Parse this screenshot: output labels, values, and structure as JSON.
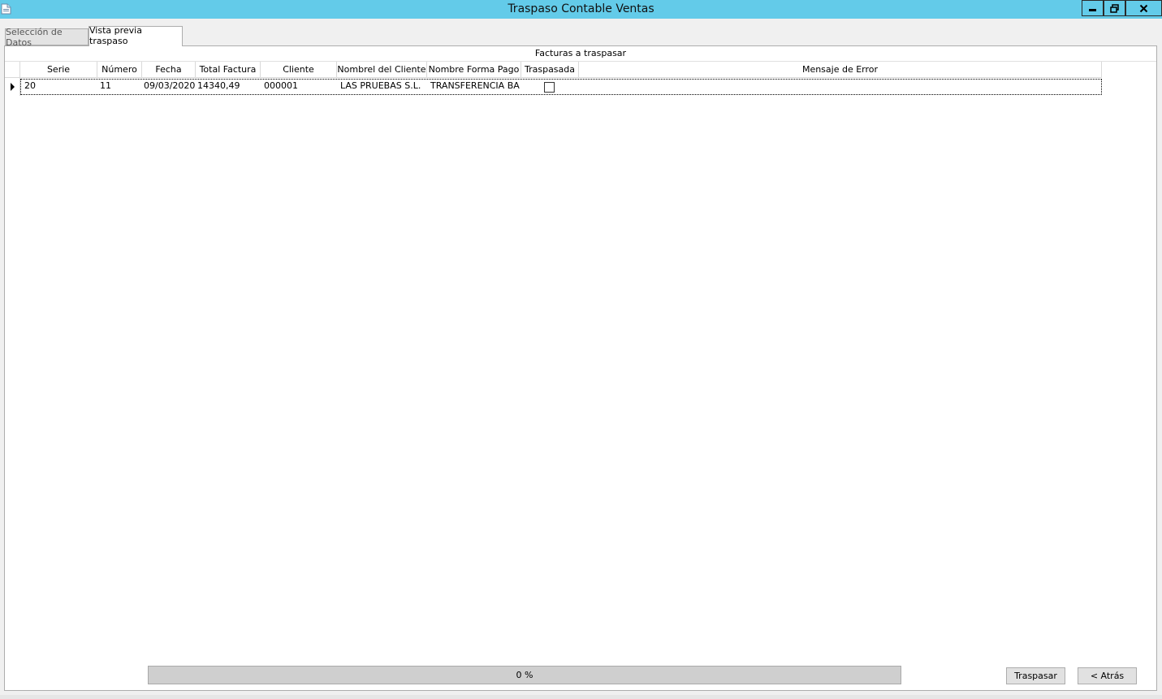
{
  "window": {
    "title": "Traspaso Contable Ventas",
    "accent_color": "#63cbe9",
    "controls": [
      "minimize-icon",
      "restore-icon",
      "close-icon"
    ]
  },
  "tabs": [
    {
      "label": "Selección de Datos",
      "selected": false
    },
    {
      "label": "Vista previa traspaso",
      "selected": true
    }
  ],
  "grid": {
    "caption": "Facturas a traspasar",
    "columns": [
      "Serie",
      "Número",
      "Fecha",
      "Total Factura",
      "Cliente",
      "Nombrel del Cliente",
      "Nombre Forma Pago",
      "Traspasada",
      "Mensaje de Error"
    ],
    "rows": [
      {
        "serie": "20",
        "numero": "11",
        "fecha": "09/03/2020",
        "total": "14340,49",
        "cliente": "000001",
        "nombre_cliente": "LAS PRUEBAS S.L.",
        "forma_pago": "TRANSFERENCIA BAN",
        "traspasada": false,
        "mensaje_error": ""
      }
    ]
  },
  "progress": {
    "label": "0 %",
    "value": 0
  },
  "buttons": {
    "transfer": "Traspasar",
    "back": "< Atrás"
  }
}
